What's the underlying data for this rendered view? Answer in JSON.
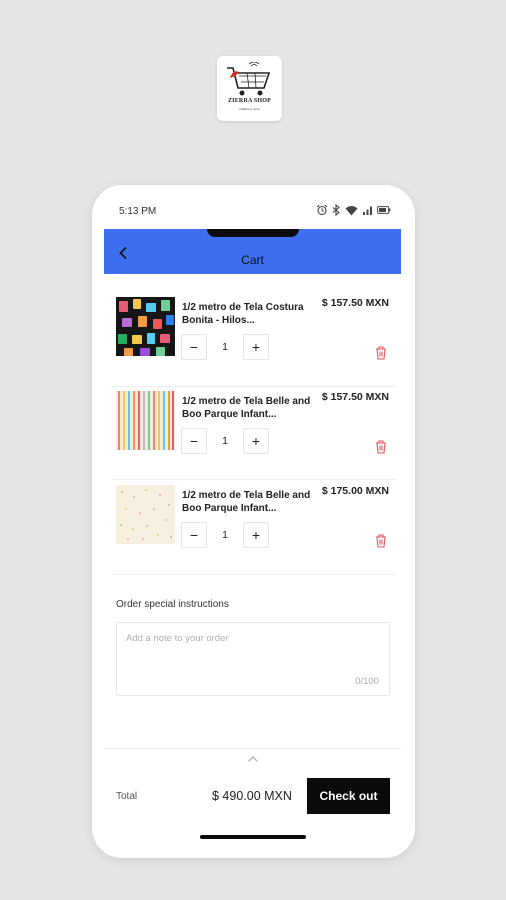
{
  "store_logo": {
    "name": "ZIERRA SHOP",
    "tagline": "Fabrics & more"
  },
  "status_bar": {
    "time": "5:13 PM"
  },
  "header": {
    "title": "Cart"
  },
  "cart_items": [
    {
      "title": "1/2 metro de Tela Costura Bonita - Hilos...",
      "price": "$ 157.50 MXN",
      "quantity": "1"
    },
    {
      "title": "1/2 metro de Tela Belle and Boo Parque Infant...",
      "price": "$ 157.50 MXN",
      "quantity": "1"
    },
    {
      "title": "1/2 metro de Tela Belle and Boo Parque Infant...",
      "price": "$ 175.00 MXN",
      "quantity": "1"
    }
  ],
  "stepper": {
    "minus": "−",
    "plus": "+"
  },
  "notes": {
    "label": "Order special instructions",
    "placeholder": "Add a note to your order",
    "counter": "0/100"
  },
  "footer": {
    "total_label": "Total",
    "total_value": "$ 490.00 MXN",
    "checkout_label": "Check out"
  },
  "colors": {
    "header_bg": "#3d6ff0",
    "checkout_bg": "#0a0a0a",
    "trash": "#e05555"
  }
}
